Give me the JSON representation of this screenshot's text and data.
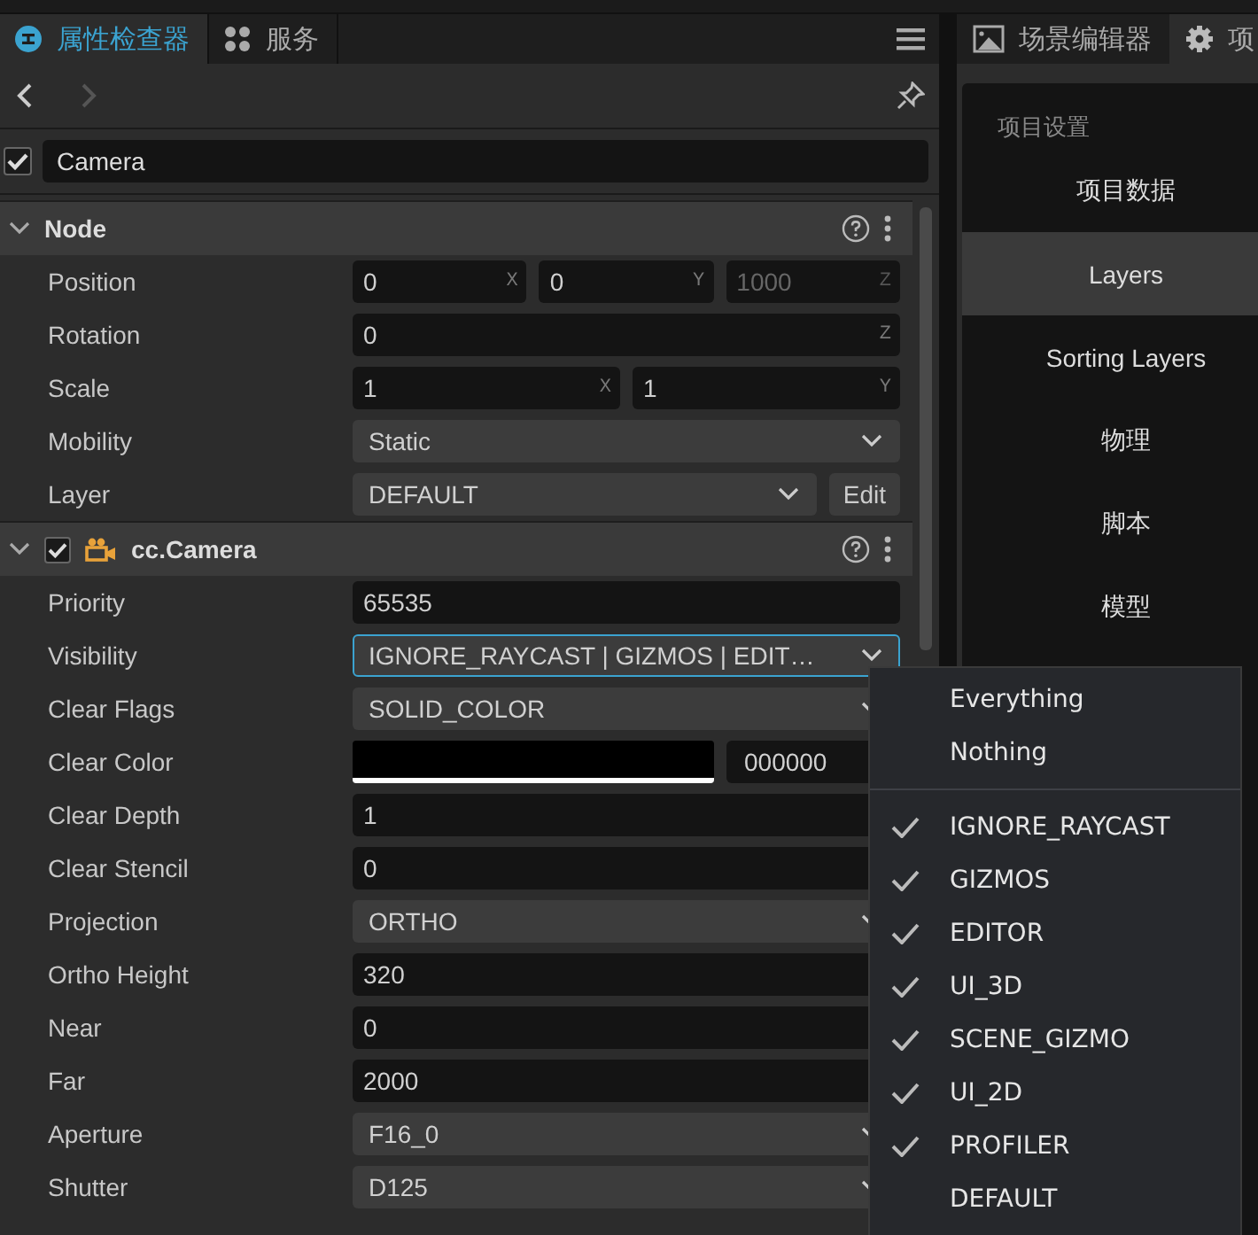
{
  "left_tabs": [
    {
      "label": "属性检查器",
      "selected": true
    },
    {
      "label": "服务",
      "selected": false
    }
  ],
  "toolbar": {
    "forward_disabled": true
  },
  "node_name": {
    "enabled": true,
    "value": "Camera"
  },
  "sections": [
    {
      "title": "Node",
      "kind": "node",
      "expanded": true,
      "rows": [
        {
          "label": "Position",
          "kind": "vector",
          "parts": [
            {
              "value": "0",
              "axis": "X",
              "disabled": false
            },
            {
              "value": "0",
              "axis": "Y",
              "disabled": false
            },
            {
              "value": "1000",
              "axis": "Z",
              "disabled": true
            }
          ]
        },
        {
          "label": "Rotation",
          "kind": "vector",
          "parts": [
            {
              "value": "0",
              "axis": "Z",
              "disabled": false
            }
          ]
        },
        {
          "label": "Scale",
          "kind": "vector",
          "parts": [
            {
              "value": "1",
              "axis": "X",
              "disabled": false
            },
            {
              "value": "1",
              "axis": "Y",
              "disabled": false
            }
          ]
        },
        {
          "label": "Mobility",
          "kind": "select",
          "value": "Static",
          "focused": false
        },
        {
          "label": "Layer",
          "kind": "select",
          "value": "DEFAULT",
          "focused": false,
          "button": "Edit"
        }
      ]
    },
    {
      "title": "cc.Camera",
      "kind": "component",
      "checked": true,
      "expanded": true,
      "rows": [
        {
          "label": "Priority",
          "kind": "number",
          "value": "65535"
        },
        {
          "label": "Visibility",
          "kind": "select",
          "value": "IGNORE_RAYCAST | GIZMOS | EDIT…",
          "focused": true
        },
        {
          "label": "Clear Flags",
          "kind": "select",
          "value": "SOLID_COLOR",
          "focused": false
        },
        {
          "label": "Clear Color",
          "kind": "color",
          "color": "#000000",
          "value": "000000"
        },
        {
          "label": "Clear Depth",
          "kind": "number",
          "value": "1"
        },
        {
          "label": "Clear Stencil",
          "kind": "number",
          "value": "0"
        },
        {
          "label": "Projection",
          "kind": "select",
          "value": "ORTHO",
          "focused": false
        },
        {
          "label": "Ortho Height",
          "kind": "number",
          "value": "320"
        },
        {
          "label": "Near",
          "kind": "number",
          "value": "0"
        },
        {
          "label": "Far",
          "kind": "number",
          "value": "2000"
        },
        {
          "label": "Aperture",
          "kind": "select",
          "value": "F16_0",
          "focused": false
        },
        {
          "label": "Shutter",
          "kind": "select",
          "value": "D125",
          "focused": false
        }
      ]
    }
  ],
  "right_tabs": [
    {
      "label": "场景编辑器",
      "selected": false
    },
    {
      "label": "项",
      "selected": true
    }
  ],
  "settings_nav": {
    "heading": "项目设置",
    "items": [
      {
        "label": "项目数据",
        "selected": false
      },
      {
        "label": "Layers",
        "selected": true
      },
      {
        "label": "Sorting Layers",
        "selected": false
      },
      {
        "label": "物理",
        "selected": false
      },
      {
        "label": "脚本",
        "selected": false
      },
      {
        "label": "模型",
        "selected": false
      }
    ]
  },
  "visibility_menu": {
    "presets": [
      "Everything",
      "Nothing"
    ],
    "layers": [
      {
        "label": "IGNORE_RAYCAST",
        "checked": true
      },
      {
        "label": "GIZMOS",
        "checked": true
      },
      {
        "label": "EDITOR",
        "checked": true
      },
      {
        "label": "UI_3D",
        "checked": true
      },
      {
        "label": "SCENE_GIZMO",
        "checked": true
      },
      {
        "label": "UI_2D",
        "checked": true
      },
      {
        "label": "PROFILER",
        "checked": true
      },
      {
        "label": "DEFAULT",
        "checked": false
      }
    ]
  }
}
